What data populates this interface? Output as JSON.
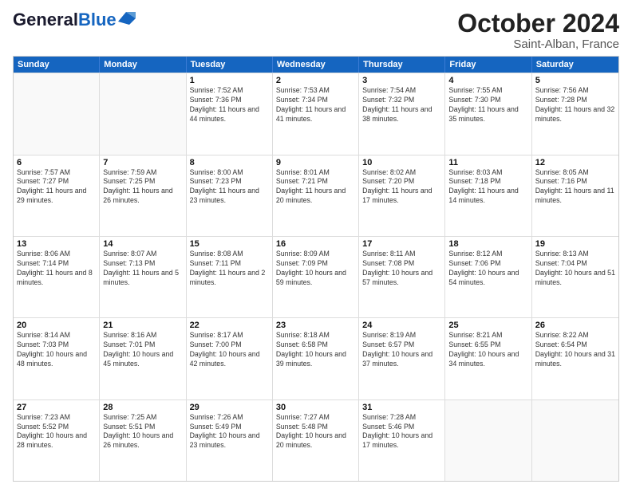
{
  "header": {
    "logo_general": "General",
    "logo_blue": "Blue",
    "title": "October 2024",
    "subtitle": "Saint-Alban, France"
  },
  "calendar": {
    "days_of_week": [
      "Sunday",
      "Monday",
      "Tuesday",
      "Wednesday",
      "Thursday",
      "Friday",
      "Saturday"
    ],
    "rows": [
      [
        {
          "day": "",
          "text": "",
          "empty": true
        },
        {
          "day": "",
          "text": "",
          "empty": true
        },
        {
          "day": "1",
          "text": "Sunrise: 7:52 AM\nSunset: 7:36 PM\nDaylight: 11 hours and 44 minutes."
        },
        {
          "day": "2",
          "text": "Sunrise: 7:53 AM\nSunset: 7:34 PM\nDaylight: 11 hours and 41 minutes."
        },
        {
          "day": "3",
          "text": "Sunrise: 7:54 AM\nSunset: 7:32 PM\nDaylight: 11 hours and 38 minutes."
        },
        {
          "day": "4",
          "text": "Sunrise: 7:55 AM\nSunset: 7:30 PM\nDaylight: 11 hours and 35 minutes."
        },
        {
          "day": "5",
          "text": "Sunrise: 7:56 AM\nSunset: 7:28 PM\nDaylight: 11 hours and 32 minutes."
        }
      ],
      [
        {
          "day": "6",
          "text": "Sunrise: 7:57 AM\nSunset: 7:27 PM\nDaylight: 11 hours and 29 minutes."
        },
        {
          "day": "7",
          "text": "Sunrise: 7:59 AM\nSunset: 7:25 PM\nDaylight: 11 hours and 26 minutes."
        },
        {
          "day": "8",
          "text": "Sunrise: 8:00 AM\nSunset: 7:23 PM\nDaylight: 11 hours and 23 minutes."
        },
        {
          "day": "9",
          "text": "Sunrise: 8:01 AM\nSunset: 7:21 PM\nDaylight: 11 hours and 20 minutes."
        },
        {
          "day": "10",
          "text": "Sunrise: 8:02 AM\nSunset: 7:20 PM\nDaylight: 11 hours and 17 minutes."
        },
        {
          "day": "11",
          "text": "Sunrise: 8:03 AM\nSunset: 7:18 PM\nDaylight: 11 hours and 14 minutes."
        },
        {
          "day": "12",
          "text": "Sunrise: 8:05 AM\nSunset: 7:16 PM\nDaylight: 11 hours and 11 minutes."
        }
      ],
      [
        {
          "day": "13",
          "text": "Sunrise: 8:06 AM\nSunset: 7:14 PM\nDaylight: 11 hours and 8 minutes."
        },
        {
          "day": "14",
          "text": "Sunrise: 8:07 AM\nSunset: 7:13 PM\nDaylight: 11 hours and 5 minutes."
        },
        {
          "day": "15",
          "text": "Sunrise: 8:08 AM\nSunset: 7:11 PM\nDaylight: 11 hours and 2 minutes."
        },
        {
          "day": "16",
          "text": "Sunrise: 8:09 AM\nSunset: 7:09 PM\nDaylight: 10 hours and 59 minutes."
        },
        {
          "day": "17",
          "text": "Sunrise: 8:11 AM\nSunset: 7:08 PM\nDaylight: 10 hours and 57 minutes."
        },
        {
          "day": "18",
          "text": "Sunrise: 8:12 AM\nSunset: 7:06 PM\nDaylight: 10 hours and 54 minutes."
        },
        {
          "day": "19",
          "text": "Sunrise: 8:13 AM\nSunset: 7:04 PM\nDaylight: 10 hours and 51 minutes."
        }
      ],
      [
        {
          "day": "20",
          "text": "Sunrise: 8:14 AM\nSunset: 7:03 PM\nDaylight: 10 hours and 48 minutes."
        },
        {
          "day": "21",
          "text": "Sunrise: 8:16 AM\nSunset: 7:01 PM\nDaylight: 10 hours and 45 minutes."
        },
        {
          "day": "22",
          "text": "Sunrise: 8:17 AM\nSunset: 7:00 PM\nDaylight: 10 hours and 42 minutes."
        },
        {
          "day": "23",
          "text": "Sunrise: 8:18 AM\nSunset: 6:58 PM\nDaylight: 10 hours and 39 minutes."
        },
        {
          "day": "24",
          "text": "Sunrise: 8:19 AM\nSunset: 6:57 PM\nDaylight: 10 hours and 37 minutes."
        },
        {
          "day": "25",
          "text": "Sunrise: 8:21 AM\nSunset: 6:55 PM\nDaylight: 10 hours and 34 minutes."
        },
        {
          "day": "26",
          "text": "Sunrise: 8:22 AM\nSunset: 6:54 PM\nDaylight: 10 hours and 31 minutes."
        }
      ],
      [
        {
          "day": "27",
          "text": "Sunrise: 7:23 AM\nSunset: 5:52 PM\nDaylight: 10 hours and 28 minutes."
        },
        {
          "day": "28",
          "text": "Sunrise: 7:25 AM\nSunset: 5:51 PM\nDaylight: 10 hours and 26 minutes."
        },
        {
          "day": "29",
          "text": "Sunrise: 7:26 AM\nSunset: 5:49 PM\nDaylight: 10 hours and 23 minutes."
        },
        {
          "day": "30",
          "text": "Sunrise: 7:27 AM\nSunset: 5:48 PM\nDaylight: 10 hours and 20 minutes."
        },
        {
          "day": "31",
          "text": "Sunrise: 7:28 AM\nSunset: 5:46 PM\nDaylight: 10 hours and 17 minutes."
        },
        {
          "day": "",
          "text": "",
          "empty": true
        },
        {
          "day": "",
          "text": "",
          "empty": true
        }
      ]
    ]
  }
}
